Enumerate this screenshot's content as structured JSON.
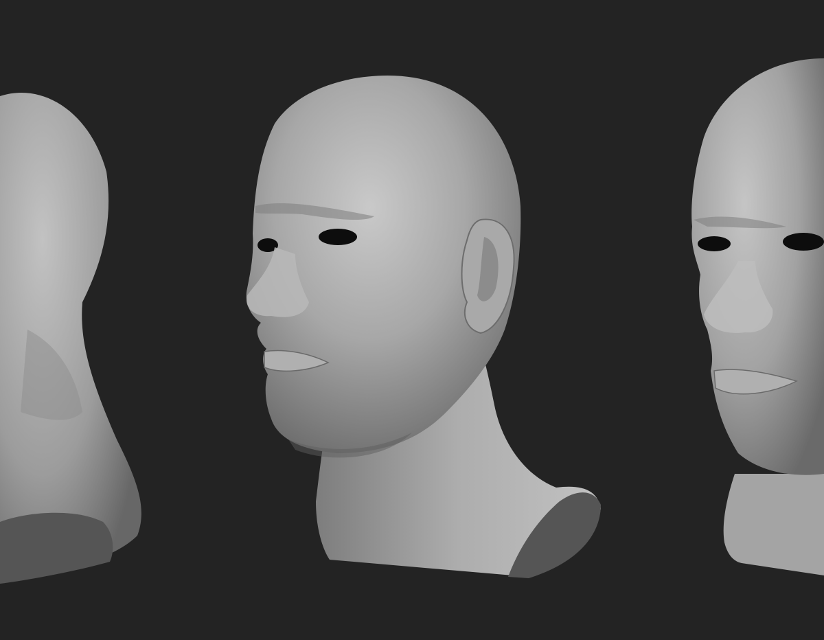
{
  "scene": {
    "background_color": "#232323",
    "subject": "sculpted-head-bust",
    "material_color": "#9a9a9a",
    "cut_surface_color": "#555555",
    "views": [
      {
        "id": "left",
        "angle": "back-three-quarter",
        "cropped": true
      },
      {
        "id": "center",
        "angle": "three-quarter-left",
        "cropped": false
      },
      {
        "id": "right",
        "angle": "front-three-quarter",
        "cropped": true
      }
    ]
  }
}
